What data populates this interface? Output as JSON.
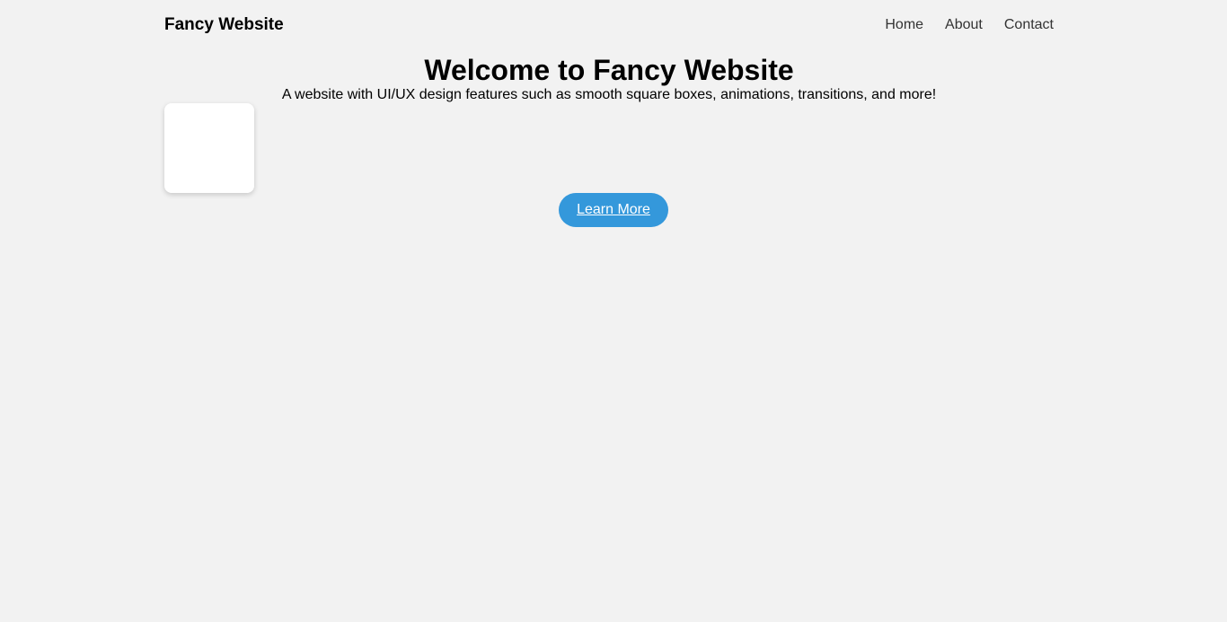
{
  "header": {
    "brand": "Fancy Website",
    "nav": [
      {
        "label": "Home"
      },
      {
        "label": "About"
      },
      {
        "label": "Contact"
      }
    ]
  },
  "hero": {
    "title": "Welcome to Fancy Website",
    "subtitle": "A website with UI/UX design features such as smooth square boxes, animations, transitions, and more!",
    "button_label": "Learn More"
  },
  "colors": {
    "background": "#f2f2f2",
    "accent": "#3498db",
    "box": "#ffffff"
  }
}
